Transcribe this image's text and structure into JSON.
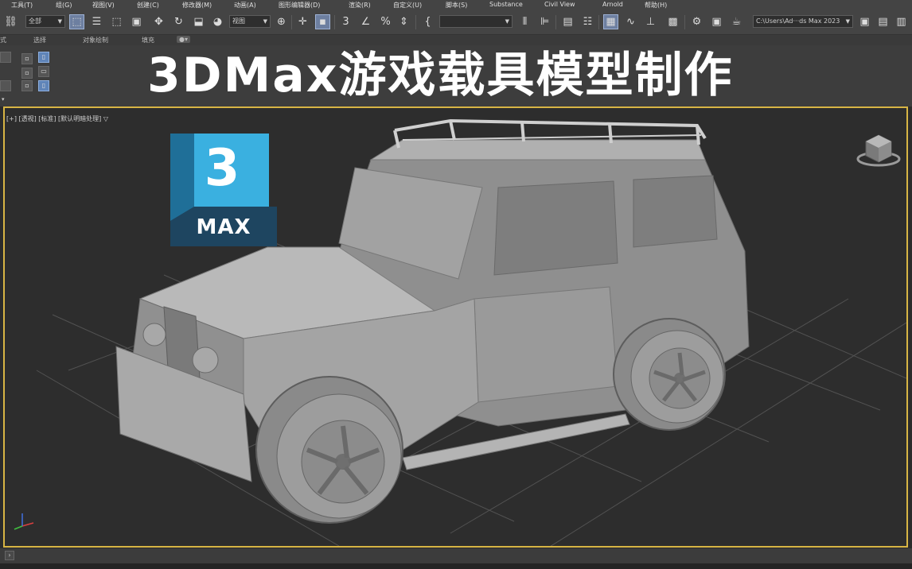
{
  "menu": {
    "items": [
      "工具(T)",
      "组(G)",
      "视图(V)",
      "创建(C)",
      "修改器(M)",
      "动画(A)",
      "图形编辑器(D)",
      "渲染(R)",
      "自定义(U)",
      "脚本(S)",
      "Substance",
      "Civil View",
      "Arnold",
      "帮助(H)"
    ]
  },
  "toolbar": {
    "selection_filter": "全部",
    "reference_coord": "视图",
    "named_selection": "",
    "project_path": "C:\\Users\\Ad···ds Max 2023"
  },
  "ribbon": {
    "tabs": [
      "选择",
      "对象绘制",
      "填充"
    ]
  },
  "title": "3DMax游戏载具模型制作",
  "viewport": {
    "label": "[+] [透视] [标准] [默认明暗处理]",
    "filter_icon": "funnel-icon"
  },
  "logo": {
    "number": "3",
    "text": "MAX"
  },
  "colors": {
    "viewport_border": "#d7b444",
    "logo_blue_light": "#3ab0e0",
    "logo_blue_dark": "#1f6f98",
    "logo_teal": "#2a8aab",
    "logo_bottom": "#1e4560",
    "grid_line": "#5a5a5a"
  }
}
